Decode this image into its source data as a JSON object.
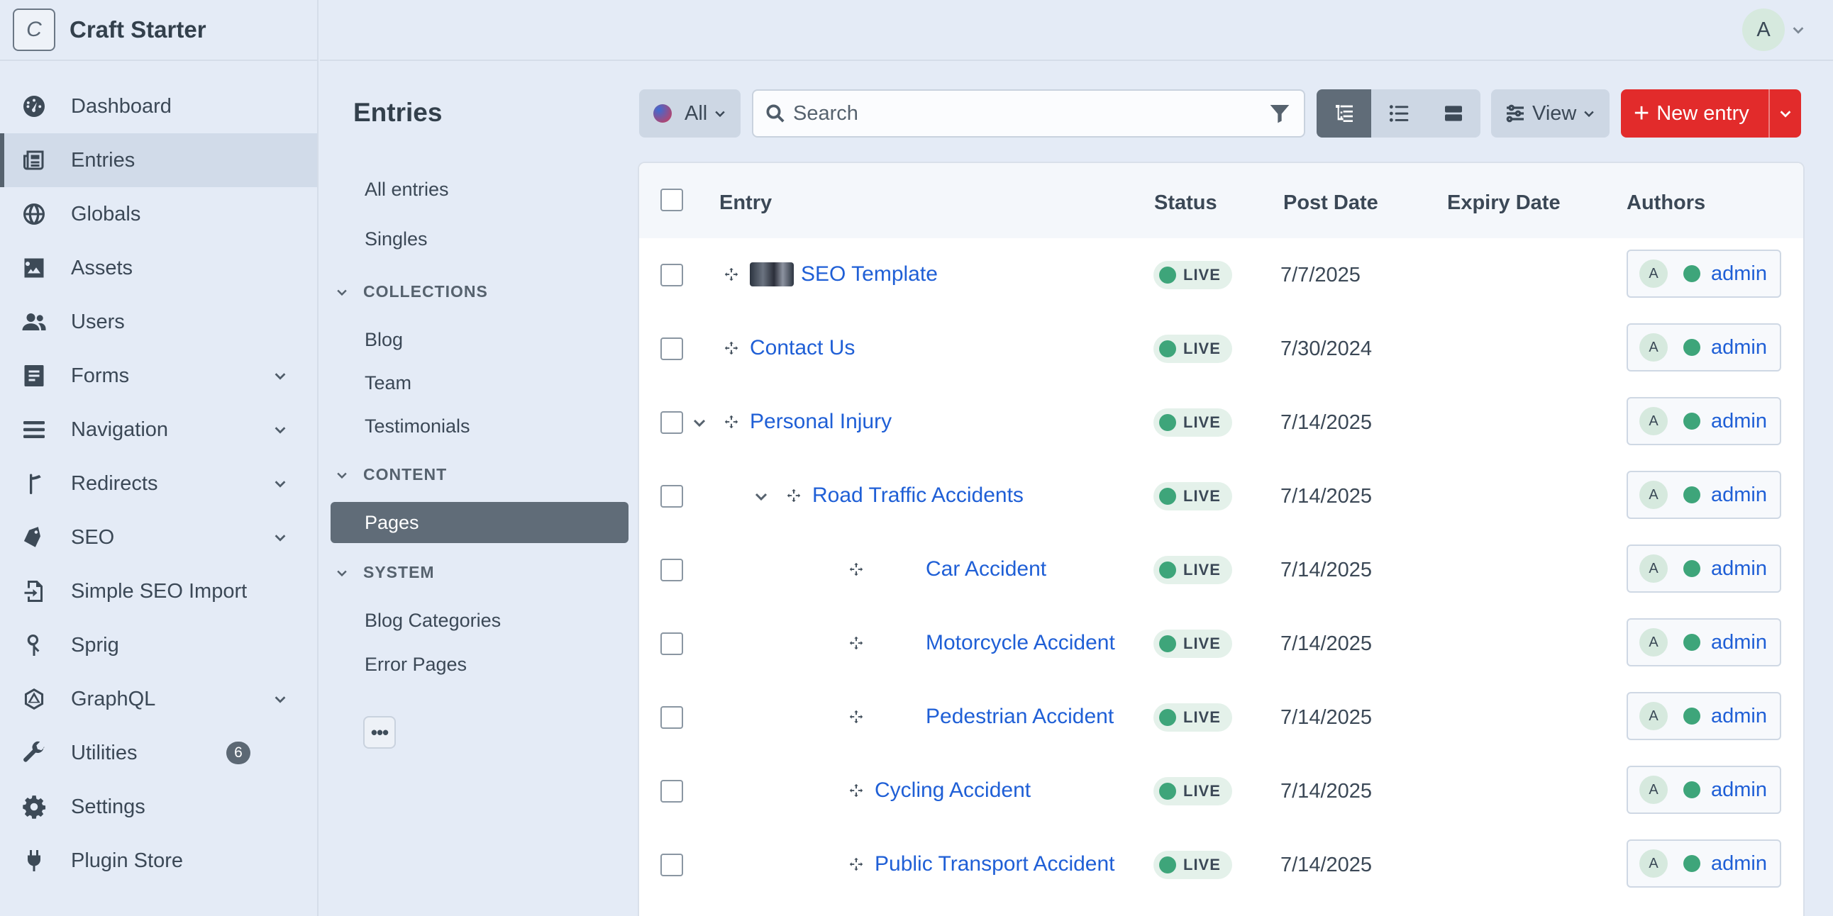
{
  "site": {
    "logo_letter": "C",
    "name": "Craft Starter"
  },
  "user": {
    "initial": "A"
  },
  "nav": {
    "items": [
      {
        "label": "Dashboard",
        "icon": "dashboard-icon"
      },
      {
        "label": "Entries",
        "icon": "entries-icon"
      },
      {
        "label": "Globals",
        "icon": "globe-icon"
      },
      {
        "label": "Assets",
        "icon": "image-icon"
      },
      {
        "label": "Users",
        "icon": "users-icon"
      },
      {
        "label": "Forms",
        "icon": "form-icon"
      },
      {
        "label": "Navigation",
        "icon": "bars-icon"
      },
      {
        "label": "Redirects",
        "icon": "signpost-icon"
      },
      {
        "label": "SEO",
        "icon": "tag-icon"
      },
      {
        "label": "Simple SEO Import",
        "icon": "import-icon"
      },
      {
        "label": "Sprig",
        "icon": "sprig-icon"
      },
      {
        "label": "GraphQL",
        "icon": "graphql-icon"
      },
      {
        "label": "Utilities",
        "icon": "wrench-icon",
        "badge": "6"
      },
      {
        "label": "Settings",
        "icon": "gear-icon"
      },
      {
        "label": "Plugin Store",
        "icon": "plug-icon"
      }
    ]
  },
  "sources": {
    "title": "Entries",
    "all_entries": "All entries",
    "singles": "Singles",
    "collections_heading": "COLLECTIONS",
    "blog": "Blog",
    "team": "Team",
    "testimonials": "Testimonials",
    "content_heading": "CONTENT",
    "pages": "Pages",
    "system_heading": "SYSTEM",
    "blog_categories": "Blog Categories",
    "error_pages": "Error Pages",
    "more": "•••"
  },
  "toolbar": {
    "site_label": "All",
    "search_placeholder": "Search",
    "view_label": "View",
    "new_entry_label": "New entry",
    "new_entry_plus": "+"
  },
  "table": {
    "columns": {
      "entry": "Entry",
      "status": "Status",
      "post_date": "Post Date",
      "expiry_date": "Expiry Date",
      "authors": "Authors"
    },
    "rows": [
      {
        "title": "SEO Template",
        "status": "LIVE",
        "post_date": "7/7/2025",
        "author": "admin",
        "author_initial": "A"
      },
      {
        "title": "Contact Us",
        "status": "LIVE",
        "post_date": "7/30/2024",
        "author": "admin",
        "author_initial": "A"
      },
      {
        "title": "Personal Injury",
        "status": "LIVE",
        "post_date": "7/14/2025",
        "author": "admin",
        "author_initial": "A"
      },
      {
        "title": "Road Traffic Accidents",
        "status": "LIVE",
        "post_date": "7/14/2025",
        "author": "admin",
        "author_initial": "A"
      },
      {
        "title": "Car Accident",
        "status": "LIVE",
        "post_date": "7/14/2025",
        "author": "admin",
        "author_initial": "A"
      },
      {
        "title": "Motorcycle Accident",
        "status": "LIVE",
        "post_date": "7/14/2025",
        "author": "admin",
        "author_initial": "A"
      },
      {
        "title": "Pedestrian Accident",
        "status": "LIVE",
        "post_date": "7/14/2025",
        "author": "admin",
        "author_initial": "A"
      },
      {
        "title": "Cycling Accident",
        "status": "LIVE",
        "post_date": "7/14/2025",
        "author": "admin",
        "author_initial": "A"
      },
      {
        "title": "Public Transport Accident",
        "status": "LIVE",
        "post_date": "7/14/2025",
        "author": "admin",
        "author_initial": "A"
      }
    ]
  }
}
